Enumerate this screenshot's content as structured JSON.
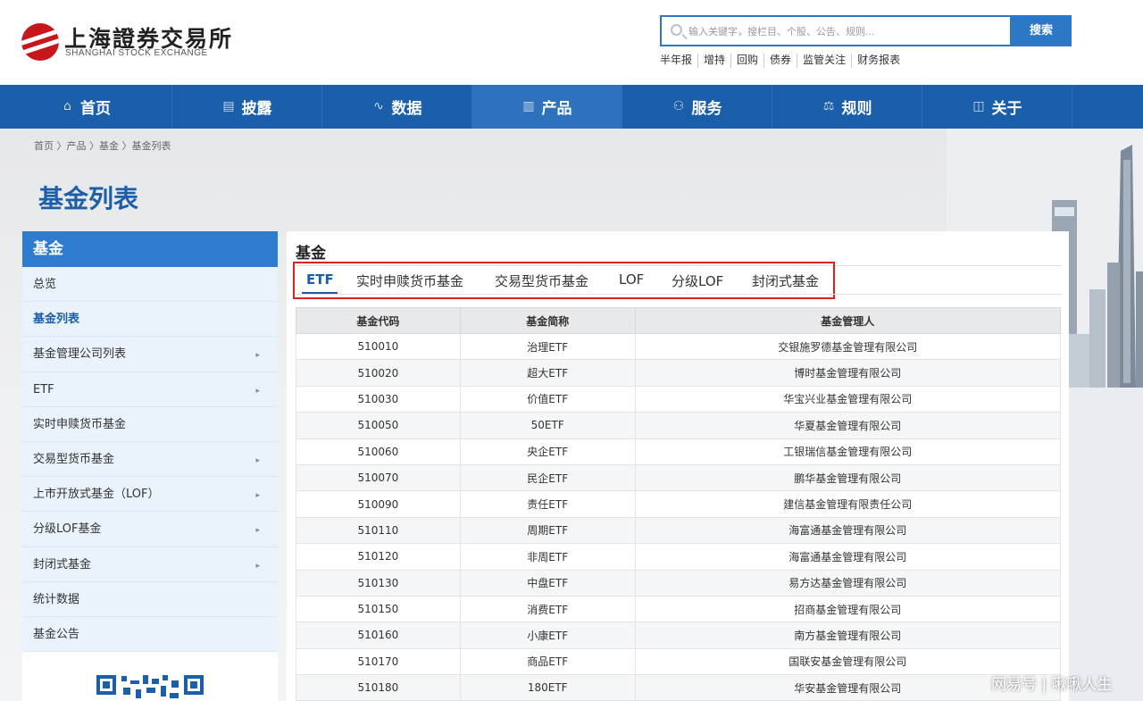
{
  "header": {
    "logo_cn": "上海證券交易所",
    "logo_en": "SHANGHAI STOCK EXCHANGE",
    "search_placeholder": "输入关键字，搜栏目、个股、公告、规则...",
    "search_button": "搜索",
    "hot_links": [
      "半年报",
      "增持",
      "回购",
      "债券",
      "监管关注",
      "财务报表"
    ]
  },
  "nav": {
    "items": [
      {
        "label": "首页",
        "icon": "home-icon",
        "glyph": "⌂"
      },
      {
        "label": "披露",
        "icon": "document-icon",
        "glyph": "▤"
      },
      {
        "label": "数据",
        "icon": "chart-line-icon",
        "glyph": "∿"
      },
      {
        "label": "产品",
        "icon": "bar-chart-icon",
        "glyph": "▥"
      },
      {
        "label": "服务",
        "icon": "people-icon",
        "glyph": "⚇"
      },
      {
        "label": "规则",
        "icon": "scale-icon",
        "glyph": "⚖"
      },
      {
        "label": "关于",
        "icon": "book-icon",
        "glyph": "◫"
      }
    ],
    "active": "产品"
  },
  "breadcrumb": "首页 〉产品 〉基金 〉基金列表",
  "page_title": "基金列表",
  "sidebar": {
    "title": "基金",
    "items": [
      {
        "label": "总览",
        "arrow": ""
      },
      {
        "label": "基金列表",
        "arrow": ""
      },
      {
        "label": "基金管理公司列表",
        "arrow": "▸"
      },
      {
        "label": "ETF",
        "arrow": "▸"
      },
      {
        "label": "实时申赎货币基金",
        "arrow": ""
      },
      {
        "label": "交易型货币基金",
        "arrow": "▸"
      },
      {
        "label": "上市开放式基金（LOF）",
        "arrow": "▸"
      },
      {
        "label": "分级LOF基金",
        "arrow": "▸"
      },
      {
        "label": "封闭式基金",
        "arrow": "▸"
      },
      {
        "label": "统计数据",
        "arrow": ""
      },
      {
        "label": "基金公告",
        "arrow": ""
      }
    ],
    "active": "基金列表"
  },
  "main": {
    "title": "基金",
    "tabs": [
      "ETF",
      "实时申赎货币基金",
      "交易型货币基金",
      "LOF",
      "分级LOF",
      "封闭式基金"
    ],
    "active_tab": "ETF",
    "columns": [
      "基金代码",
      "基金简称",
      "基金管理人"
    ],
    "rows": [
      [
        "510010",
        "治理ETF",
        "交银施罗德基金管理有限公司"
      ],
      [
        "510020",
        "超大ETF",
        "博时基金管理有限公司"
      ],
      [
        "510030",
        "价值ETF",
        "华宝兴业基金管理有限公司"
      ],
      [
        "510050",
        "50ETF",
        "华夏基金管理有限公司"
      ],
      [
        "510060",
        "央企ETF",
        "工银瑞信基金管理有限公司"
      ],
      [
        "510070",
        "民企ETF",
        "鹏华基金管理有限公司"
      ],
      [
        "510090",
        "责任ETF",
        "建信基金管理有限责任公司"
      ],
      [
        "510110",
        "周期ETF",
        "海富通基金管理有限公司"
      ],
      [
        "510120",
        "非周ETF",
        "海富通基金管理有限公司"
      ],
      [
        "510130",
        "中盘ETF",
        "易方达基金管理有限公司"
      ],
      [
        "510150",
        "消费ETF",
        "招商基金管理有限公司"
      ],
      [
        "510160",
        "小康ETF",
        "南方基金管理有限公司"
      ],
      [
        "510170",
        "商品ETF",
        "国联安基金管理有限公司"
      ],
      [
        "510180",
        "180ETF",
        "华安基金管理有限公司"
      ]
    ]
  },
  "colors": {
    "nav_blue": "#1b5ea9",
    "accent_blue": "#2e7bd0",
    "highlight_red": "#e02020",
    "logo_red": "#c8161d"
  },
  "watermark": "网易号 | 啾啾人生"
}
